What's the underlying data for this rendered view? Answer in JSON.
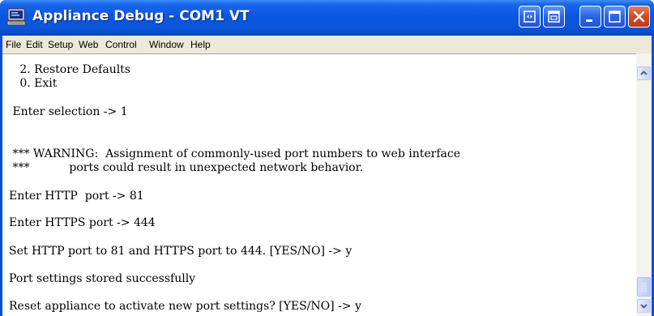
{
  "window": {
    "title": "Appliance Debug - COM1 VT",
    "controls": [
      "scroll-lock-icon",
      "restore-doc-icon",
      "minimize-icon",
      "maximize-icon",
      "close-icon"
    ]
  },
  "menu": [
    {
      "label": "File"
    },
    {
      "label": "Edit"
    },
    {
      "label": "Setup"
    },
    {
      "label": "Web"
    },
    {
      "label": "Control"
    },
    {
      "label": "Window"
    },
    {
      "label": "Help"
    }
  ],
  "terminal": {
    "lines": [
      "   2. Restore Defaults",
      "   0. Exit",
      "",
      " Enter selection -> 1",
      "",
      "",
      " *** WARNING:  Assignment of commonly-used port numbers to web interface",
      " ***           ports could result in unexpected network behavior.",
      "Enter HTTP  port -> 81",
      "Enter HTTPS port -> 444",
      "Set HTTP port to 81 and HTTPS port to 444. [YES/NO] -> y",
      "Port settings stored successfully",
      "Reset appliance to activate new port settings? [YES/NO] -> y"
    ]
  },
  "colors": {
    "title_bar": "#0a56e0",
    "menu_bg": "#ece9d8",
    "terminal_bg": "#ffffff",
    "close_button": "#d34a23"
  }
}
